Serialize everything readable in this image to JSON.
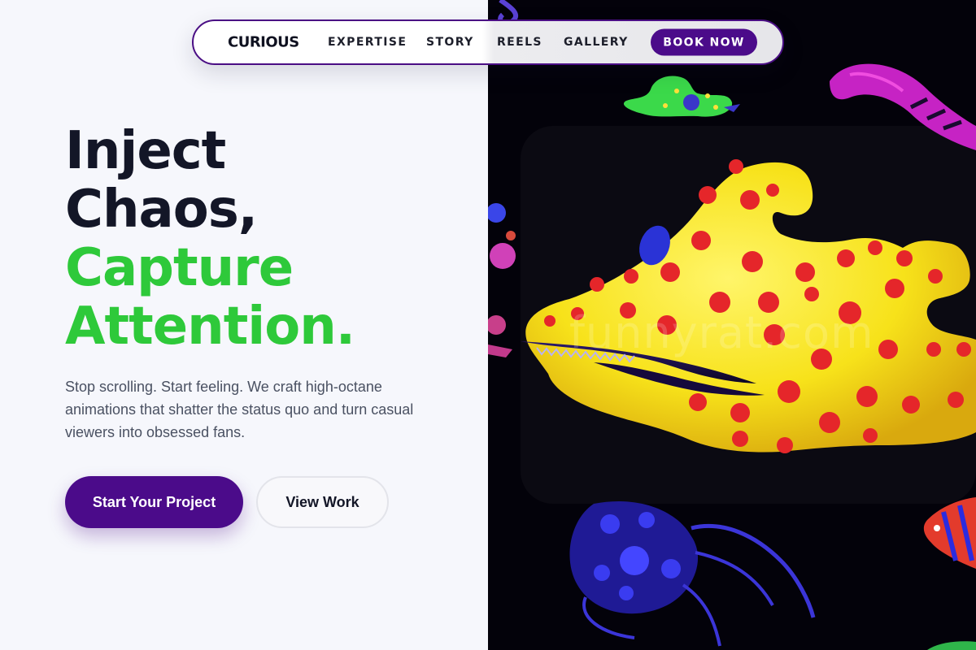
{
  "nav": {
    "logo": "CURIOUS",
    "links": [
      "EXPERTISE",
      "STORY",
      "REELS",
      "GALLERY"
    ],
    "cta": "BOOK NOW"
  },
  "hero": {
    "title_line1": "Inject",
    "title_line2": "Chaos,",
    "title_line3": "Capture",
    "title_line4": "Attention.",
    "description": "Stop scrolling. Start feeling. We craft high-octane animations that shatter the status quo and turn casual viewers into obsessed fans.",
    "primary_button": "Start Your Project",
    "secondary_button": "View Work"
  },
  "artwork": {
    "watermark": "funnyrat.com",
    "subject": "yellow-polka-dot-creature-icon"
  },
  "colors": {
    "accent_purple": "#4b0b8a",
    "accent_green": "#2ec93a",
    "text_dark": "#131627",
    "art_background": "#03020a"
  }
}
